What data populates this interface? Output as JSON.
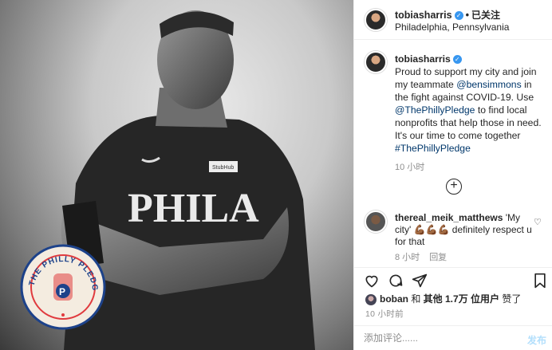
{
  "post": {
    "photo_alt_logo": "THE PHILLY PLEDGE",
    "jersey_text": "PHILA",
    "jersey_patch": "StubHub"
  },
  "header": {
    "username": "tobiasharris",
    "follow_status": "已关注",
    "location": "Philadelphia, Pennsylvania"
  },
  "caption": {
    "username": "tobiasharris",
    "text_1": "Proud to support my city and join my teammate ",
    "mention": "@bensimmons",
    "text_2": " in the fight against COVID-19. Use ",
    "mention_2": "@ThePhillyPledge",
    "text_3": " to find local nonprofits that help those in need. It's our time to come together ",
    "hashtag": "#ThePhillyPledge",
    "time": "10 小时"
  },
  "comment": {
    "username": "thereal_meik_matthews",
    "text": "'My city' 💪🏾💪🏾💪🏾 definitely respect u for that",
    "time": "8 小时",
    "reply_label": "回复"
  },
  "likes": {
    "first_user": "boban",
    "connector": " 和 ",
    "others": "其他 1.7万 位用户",
    "suffix": " 赞了"
  },
  "post_time": "10 小时前",
  "add_comment": {
    "placeholder": "添加评论......",
    "publish_label": "发布"
  },
  "icons": {
    "like": "heart-icon",
    "comment": "comment-icon",
    "share": "share-icon",
    "save": "bookmark-icon",
    "more": "plus-circle-icon"
  },
  "colors": {
    "verified": "#3897f0",
    "link": "#00376b",
    "muted": "#8e8e8e",
    "publish_disabled": "#b2dffc",
    "pledge_red": "#e03a3e",
    "pledge_blue": "#1d428a"
  }
}
